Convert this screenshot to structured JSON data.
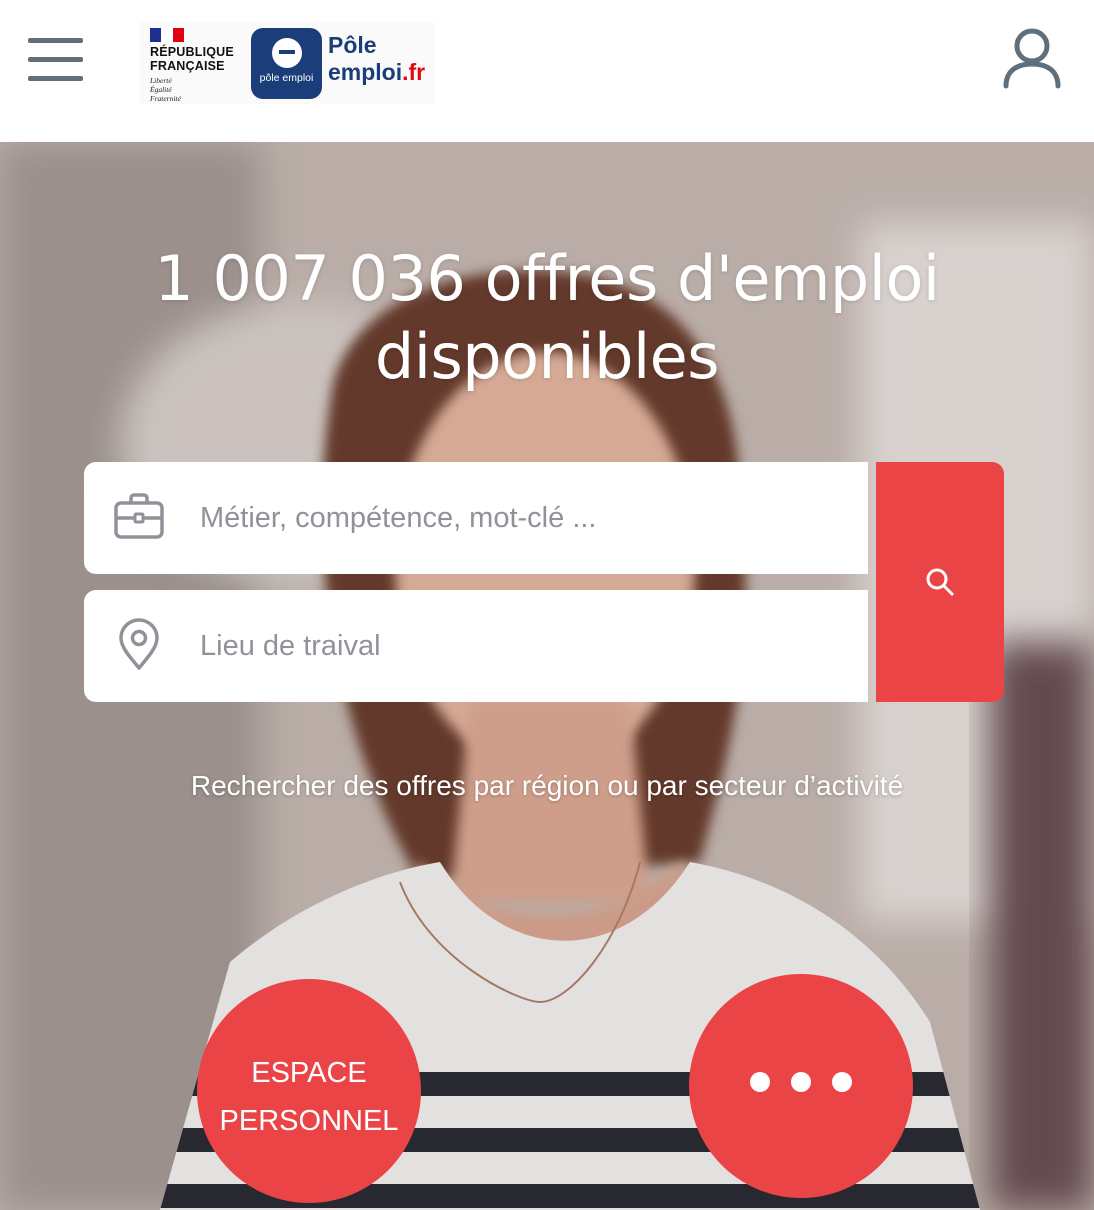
{
  "header": {
    "menu_icon": "hamburger-menu-icon",
    "logo": {
      "rf_line1": "RÉPUBLIQUE",
      "rf_line2": "FRANÇAISE",
      "devise_1": "Liberté",
      "devise_2": "Égalité",
      "devise_3": "Fraternité",
      "square_label": "pôle emploi",
      "name_line1": "Pôle",
      "name_line2_main": "emploi",
      "name_line2_suffix": ".fr"
    },
    "user_icon": "user-account-icon"
  },
  "hero": {
    "headline_count": "1 007 036",
    "headline_rest": "offres d'emploi",
    "headline_line2": "disponibles",
    "search": {
      "job_placeholder": "Métier, compétence, mot-clé ...",
      "job_icon": "briefcase-icon",
      "job_value": "",
      "place_placeholder": "Lieu de traival",
      "place_icon": "location-pin-icon",
      "place_value": "",
      "button_icon": "search-icon"
    },
    "region_link": "Rechercher des offres par région ou par secteur d’activité",
    "espace_line1": "ESPACE",
    "espace_line2": "PERSONNEL",
    "more_icon": "more-dots-icon"
  },
  "colors": {
    "accent_red": "#ea4446",
    "brand_blue": "#1b3d7a",
    "icon_gray": "#5f6f7b",
    "placeholder_gray": "#8f9399"
  }
}
